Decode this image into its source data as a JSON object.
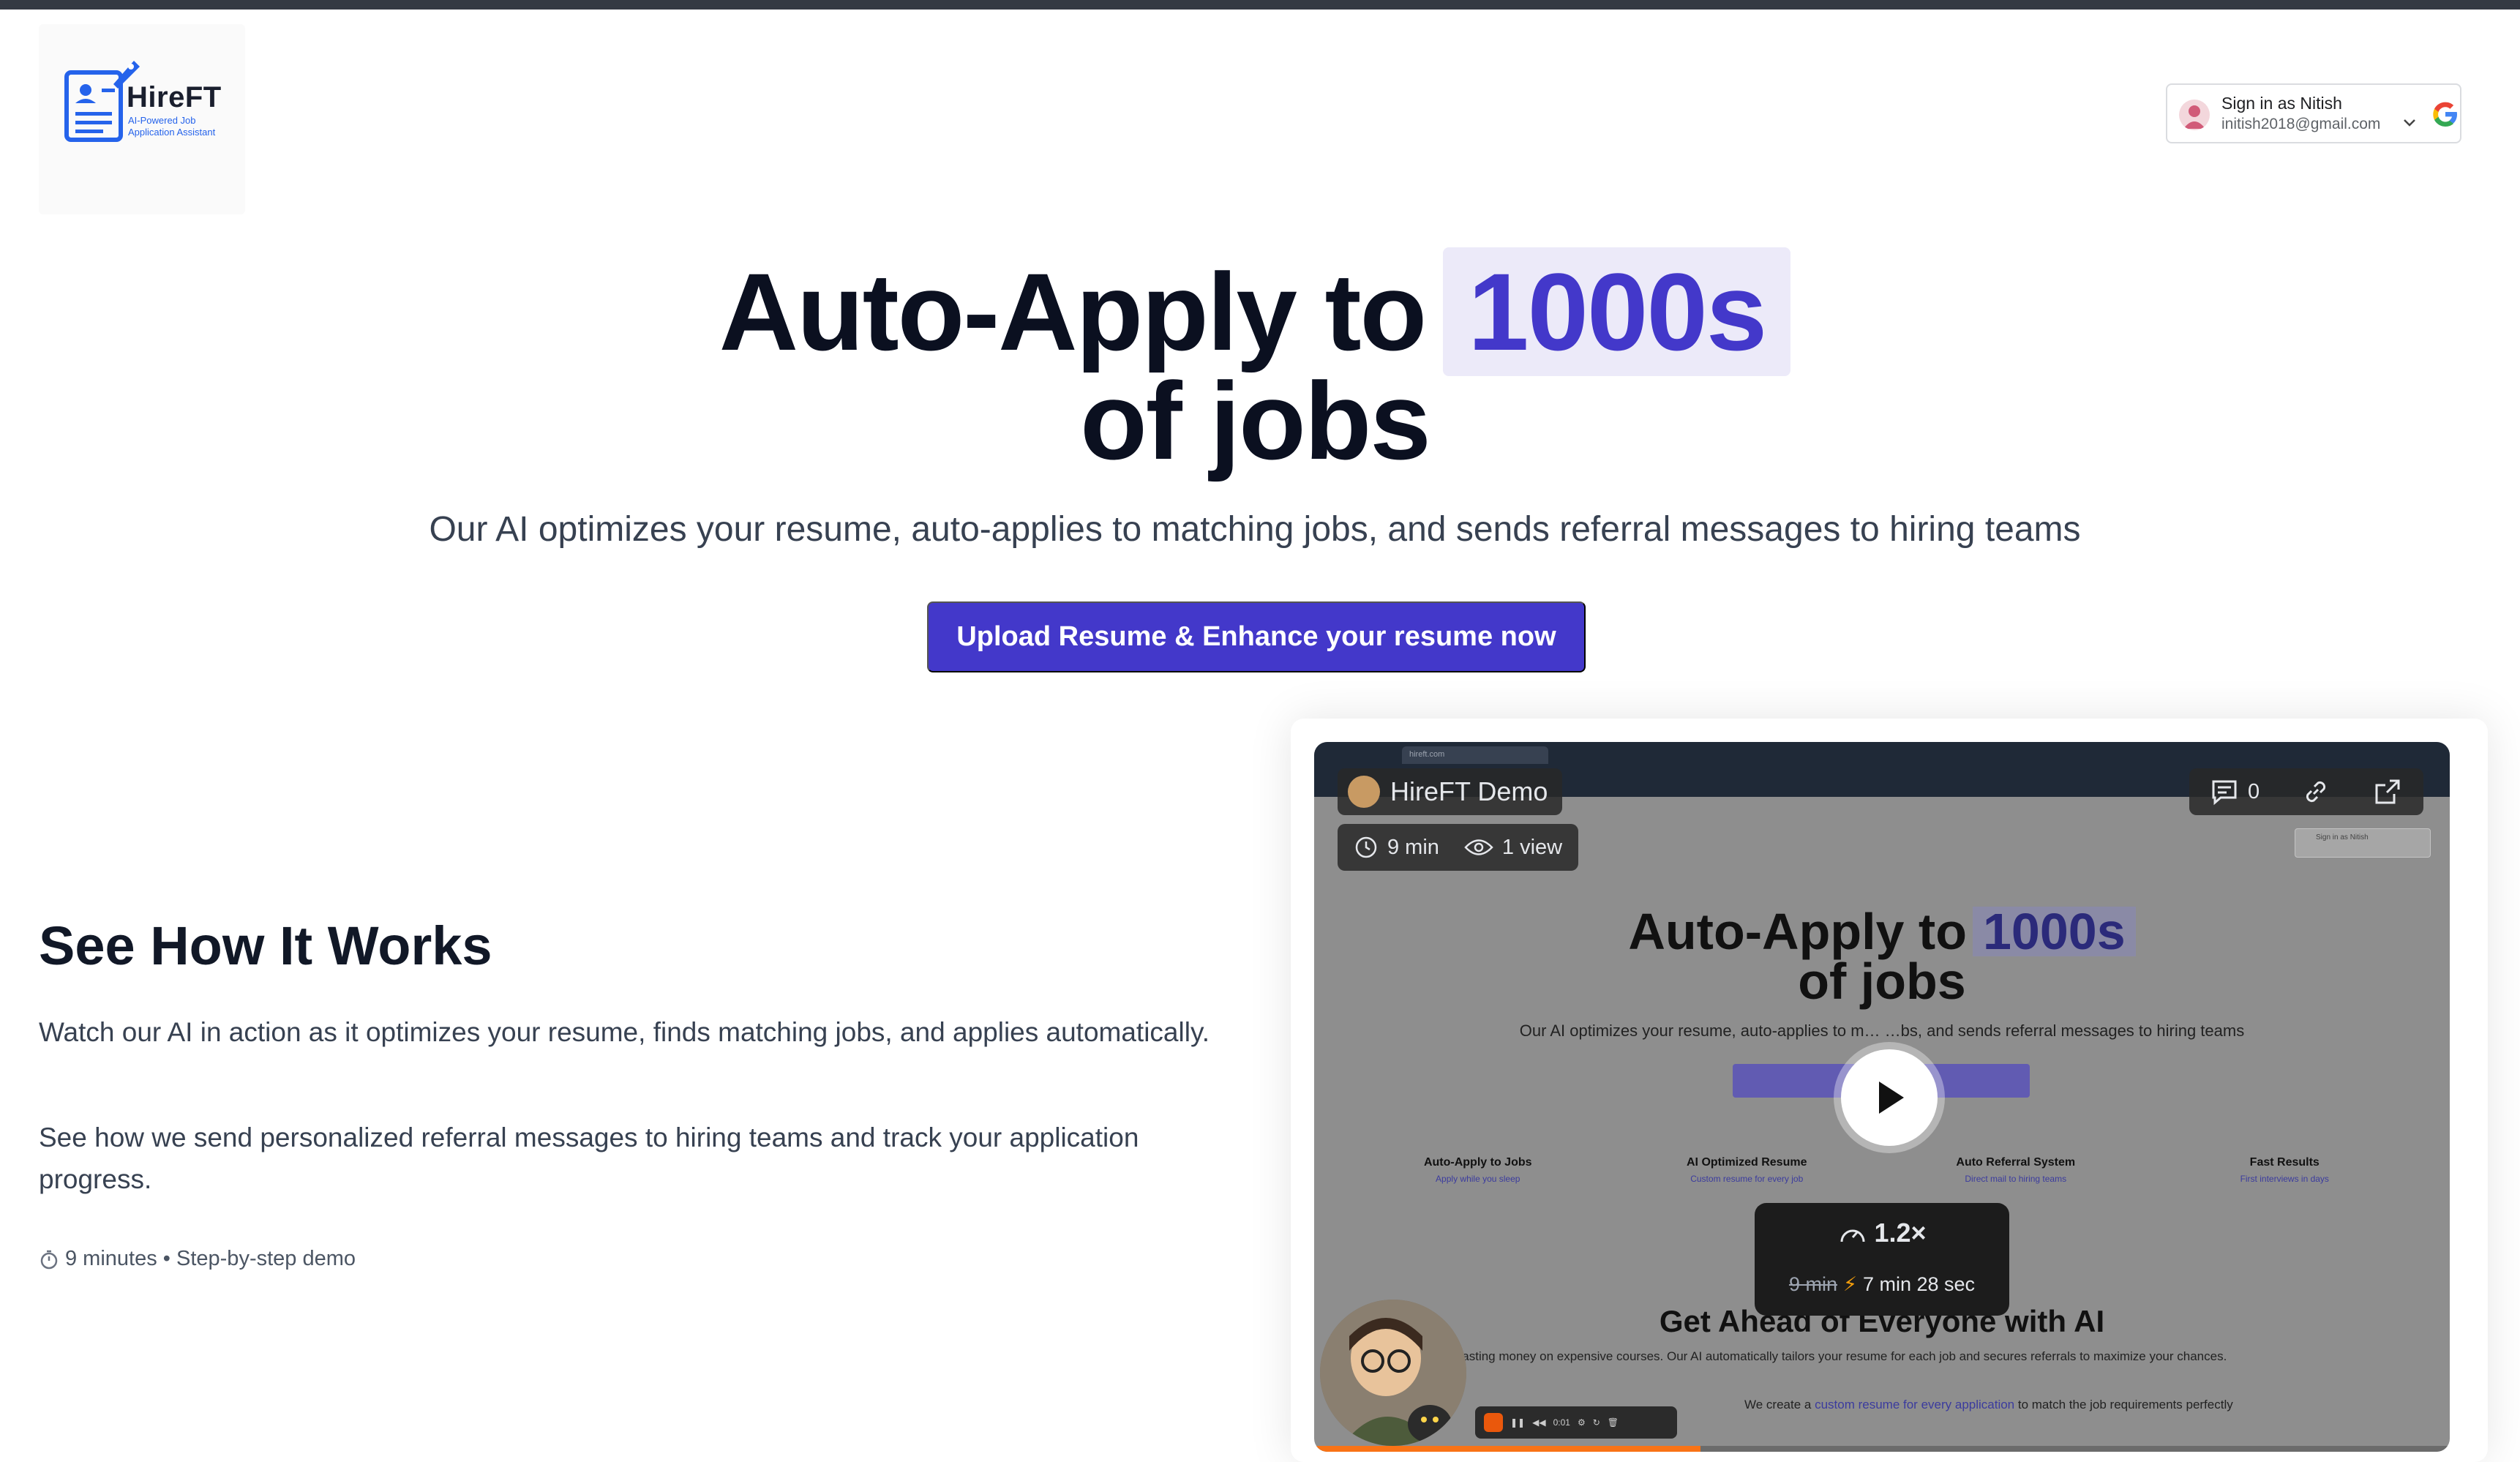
{
  "brand": {
    "name": "HireFT",
    "tagline": "AI-Powered Job Application Assistant"
  },
  "signin": {
    "name": "Sign in as Nitish",
    "email": "initish2018@gmail.com"
  },
  "hero": {
    "title_part1": "Auto-Apply to",
    "title_highlight": "1000s",
    "title_part2": "of jobs",
    "subtitle": "Our AI optimizes your resume, auto-applies to matching jobs, and sends referral messages to hiring teams",
    "cta_label": "Upload Resume & Enhance your resume now"
  },
  "how_it_works": {
    "title": "See How It Works",
    "para1": "Watch our AI in action as it optimizes your resume, finds matching jobs, and applies automatically.",
    "para2": "See how we send personalized referral messages to hiring teams and track your application progress.",
    "meta": "9 minutes • Step-by-step demo"
  },
  "video": {
    "title": "HireFT Demo",
    "duration": "9 min",
    "views": "1 view",
    "comments": "0",
    "speed": "1.2×",
    "original_time": "9 min",
    "sped_time": "7 min 28 sec",
    "rec_time": "0:01",
    "progress_fraction": 0.34,
    "inner": {
      "tab_title": "hireft.com",
      "signin": "Sign in as Nitish",
      "title_part1": "Auto-Apply to",
      "title_highlight": "1000s",
      "title_part2": "of jobs",
      "subtitle": "Our AI optimizes your resume, auto-applies to m… …bs, and sends referral messages to hiring teams",
      "features": [
        {
          "title": "Auto-Apply to Jobs",
          "sub": "Apply while you sleep"
        },
        {
          "title": "AI Optimized Resume",
          "sub": "Custom resume for every job"
        },
        {
          "title": "Auto Referral System",
          "sub": "Direct mail to hiring teams"
        },
        {
          "title": "Fast Results",
          "sub": "First interviews in days"
        }
      ],
      "ahead_title": "Get Ahead of Everyone with AI",
      "ahead_sub": "wasting money on expensive courses. Our AI automatically tailors your resume for each job and secures referrals to maximize your chances.",
      "note_prefix": "We create a",
      "note_link": "custom resume for every application",
      "note_suffix": "to match the job requirements perfectly"
    }
  },
  "colors": {
    "accent": "#4338ca",
    "highlight_bg": "#eceaf9",
    "topbar": "#343a43"
  }
}
